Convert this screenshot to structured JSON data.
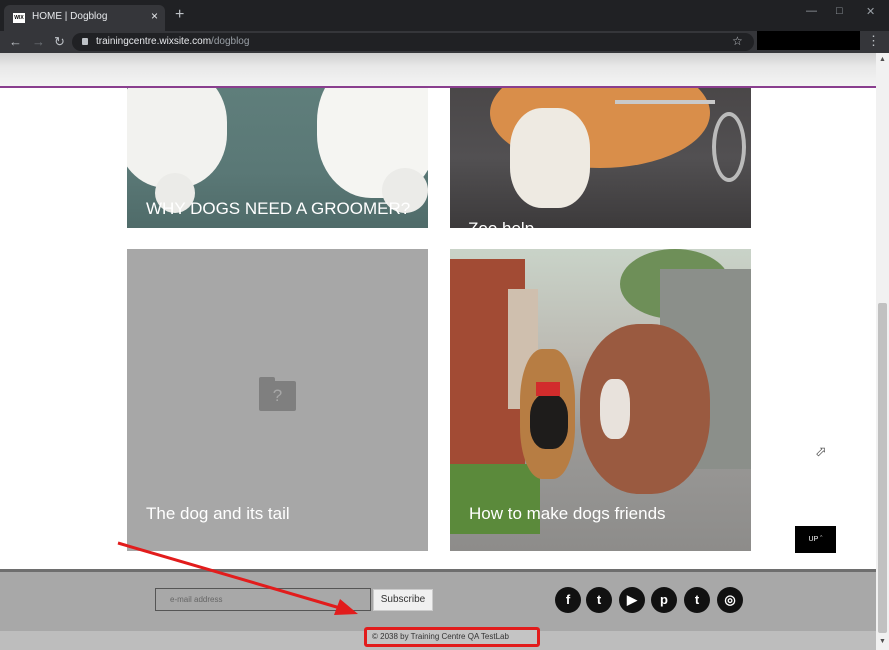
{
  "browser": {
    "tab_favicon": "WIX",
    "tab_title": "HOME | Dogblog",
    "tab_close": "×",
    "new_tab": "+",
    "url_host": "trainingcentre.wixsite.com",
    "url_path": "/dogblog",
    "icons": [
      "back-icon",
      "forward-icon",
      "reload-icon",
      "lock-icon",
      "star-icon",
      "menu-icon",
      "minimize-icon",
      "maximize-icon",
      "close-icon"
    ]
  },
  "cards": [
    {
      "title": "WHY DOGS NEED A GROOMER?"
    },
    {
      "title": "Zoo help"
    },
    {
      "title": "The dog and its tail",
      "placeholder_icon": "?"
    },
    {
      "title": "How to make dogs friends"
    }
  ],
  "up_button": {
    "label": "UP",
    "icon": "chevron-up-icon"
  },
  "footer": {
    "email_placeholder": "e-mail address",
    "subscribe_label": "Subscribe",
    "social": [
      "f",
      "t",
      "▶",
      "p",
      "t",
      "◎"
    ],
    "social_icons": [
      "facebook-icon",
      "twitter-icon",
      "youtube-icon",
      "pinterest-icon",
      "tumblr-icon",
      "instagram-icon"
    ],
    "copyright": "© 2038 by Training Centre QA TestLab"
  },
  "colors": {
    "header_accent": "#8a3f8f",
    "annotation_red": "#e21c1c",
    "footer_bg": "#a8a8a8"
  }
}
